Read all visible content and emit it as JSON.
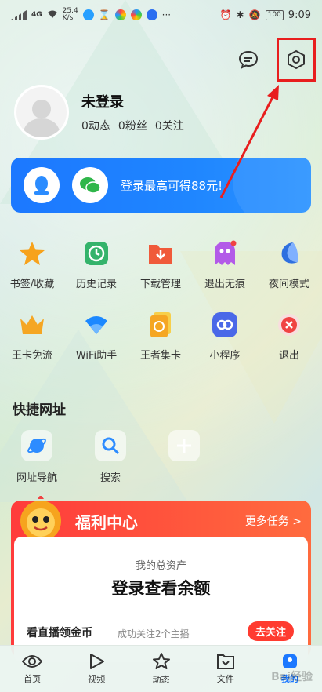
{
  "status_bar": {
    "network": "4G",
    "speed": "25.4",
    "speed_unit": "K/s",
    "battery": "100",
    "time": "9:09"
  },
  "profile": {
    "name": "未登录",
    "stats": [
      "0动态",
      "0粉丝",
      "0关注"
    ]
  },
  "banner": {
    "text": "登录最高可得88元!"
  },
  "grid": [
    {
      "label": "书签/收藏",
      "icon": "star-icon",
      "color": "#f7a21b"
    },
    {
      "label": "历史记录",
      "icon": "clock-icon",
      "color": "#34b36b"
    },
    {
      "label": "下载管理",
      "icon": "download-folder-icon",
      "color": "#f05a3a"
    },
    {
      "label": "退出无痕",
      "icon": "ghost-icon",
      "color": "#b35ae8"
    },
    {
      "label": "夜间模式",
      "icon": "moon-icon",
      "color": "#2d6fe0"
    },
    {
      "label": "王卡免流",
      "icon": "crown-icon",
      "color": "#f5a623"
    },
    {
      "label": "WiFi助手",
      "icon": "wifi-icon",
      "color": "#1c88ff"
    },
    {
      "label": "王者集卡",
      "icon": "card-icon",
      "color": "#f5b51c"
    },
    {
      "label": "小程序",
      "icon": "mini-program-icon",
      "color": "#4a68e8"
    },
    {
      "label": "退出",
      "icon": "exit-icon",
      "color": "#f04343"
    }
  ],
  "quick": {
    "title": "快捷网址",
    "items": [
      {
        "label": "网址导航",
        "icon": "planet-icon"
      },
      {
        "label": "搜索",
        "icon": "search-icon"
      },
      {
        "label": "",
        "icon": "add-icon"
      }
    ]
  },
  "welfare": {
    "title": "福利中心",
    "more": "更多任务 >",
    "subtitle": "我的总资产",
    "headline": "登录查看余额",
    "task": "看直播领金币",
    "task_sub": "成功关注2个主播",
    "follow": "去关注"
  },
  "tabs": [
    {
      "label": "首页",
      "icon": "eye-icon"
    },
    {
      "label": "视频",
      "icon": "play-icon"
    },
    {
      "label": "动态",
      "icon": "star-outline-icon"
    },
    {
      "label": "文件",
      "icon": "file-icon"
    },
    {
      "label": "我的",
      "icon": "user-icon"
    }
  ],
  "watermark": "Bai经验"
}
